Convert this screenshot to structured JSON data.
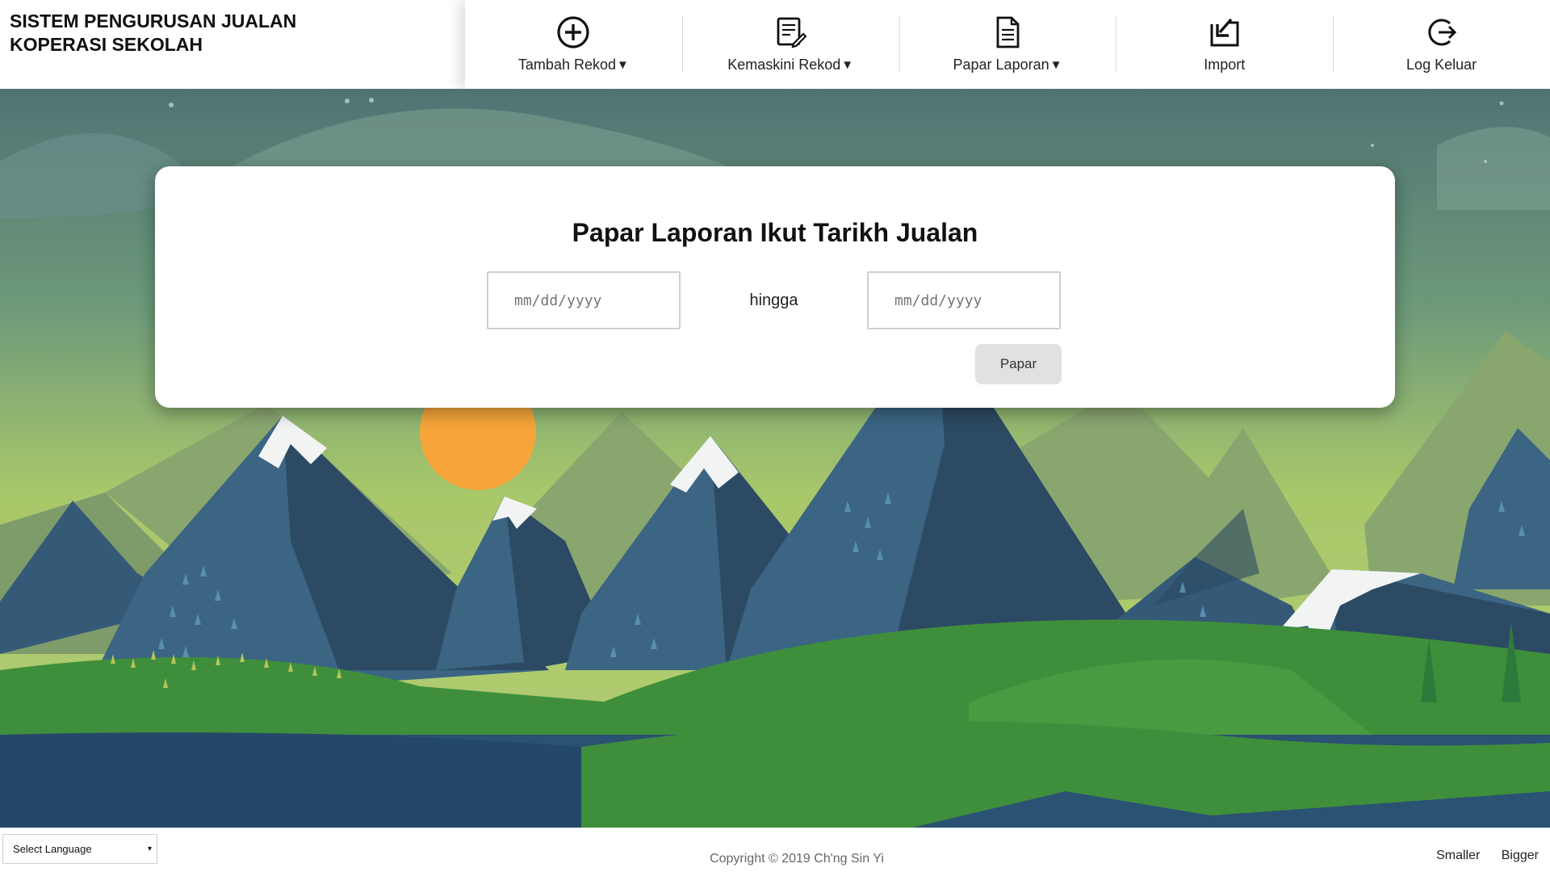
{
  "header": {
    "title_line1": "SISTEM PENGURUSAN JUALAN",
    "title_line2": "KOPERASI SEKOLAH"
  },
  "nav": {
    "items": [
      {
        "label": "Tambah Rekod",
        "caret": "▼",
        "icon": "plus-circle-icon"
      },
      {
        "label": "Kemaskini Rekod",
        "caret": "▼",
        "icon": "edit-document-icon"
      },
      {
        "label": "Papar Laporan",
        "caret": "▼",
        "icon": "document-icon"
      },
      {
        "label": "Import",
        "icon": "import-icon"
      },
      {
        "label": "Log Keluar",
        "icon": "logout-icon"
      }
    ]
  },
  "report": {
    "title": "Papar Laporan Ikut Tarikh Jualan",
    "date_from_placeholder": "mm/dd/yyyy",
    "separator": "hingga",
    "date_to_placeholder": "mm/dd/yyyy",
    "submit_label": "Papar"
  },
  "footer": {
    "language_select": "Select Language",
    "language_caret": "▾",
    "copyright": "Copyright © 2019 Ch'ng Sin Yi",
    "smaller_label": "Smaller",
    "bigger_label": "Bigger"
  },
  "colors": {
    "sky_top": "#4f7474",
    "sky_bottom": "#a9c86a",
    "mountain_dark": "#2c4a63",
    "mountain_mid": "#3b6583",
    "hill_green": "#3f8e3c",
    "sun": "#f6a53a"
  }
}
